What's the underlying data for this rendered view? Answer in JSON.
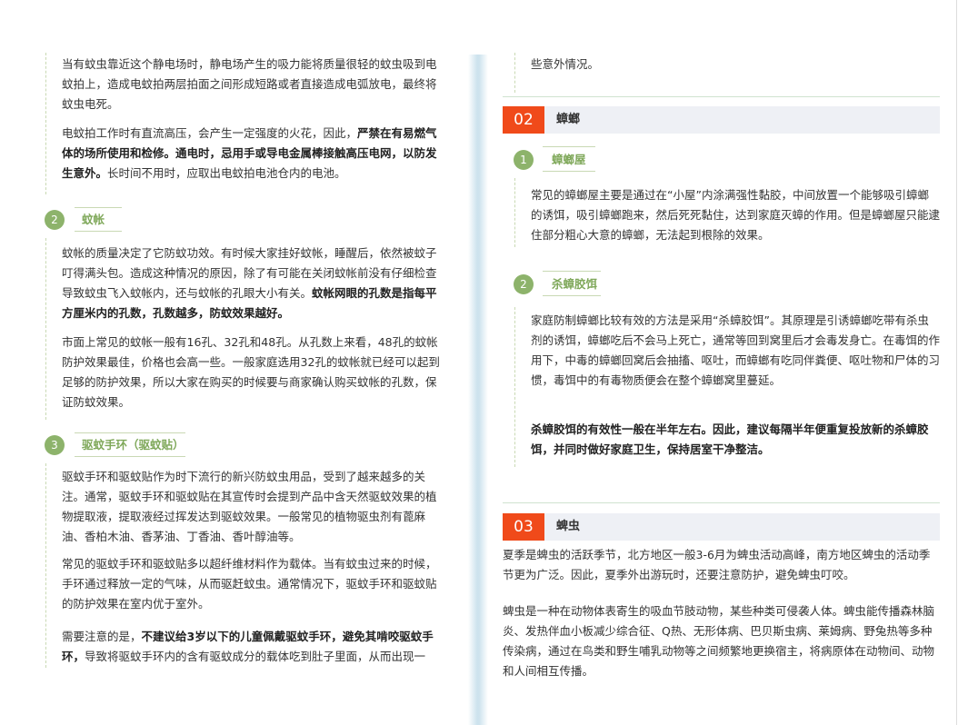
{
  "left": {
    "p1": "当有蚊虫靠近这个静电场时，静电场产生的吸力能将质量很轻的蚊虫吸到电蚊拍上，造成电蚊拍两层拍面之间形成短路或者直接造成电弧放电，最终将蚊虫电死。",
    "p2_a": "电蚊拍工作时有直流高压，会产生一定强度的火花，因此，",
    "p2_b": "严禁在有易燃气体的场所使用和检修。通电时，忌用手或导电金属棒接触高压电网，以防发生意外。",
    "p2_c": "长时间不用时，应取出电蚊拍电池仓内的电池。",
    "sub2_num": "2",
    "sub2_title": "蚊帐",
    "p3_a": "蚊帐的质量决定了它防蚊功效。有时候大家挂好蚊帐，睡醒后，依然被蚊子叮得满头包。造成这种情况的原因，除了有可能在关闭蚊帐前没有仔细检查导致蚊虫飞入蚊帐内，还与蚊帐的孔眼大小有关。",
    "p3_b": "蚊帐网眼的孔数是指每平方厘米内的孔数，孔数越多，防蚊效果越好。",
    "p4": "市面上常见的蚊帐一般有16孔、32孔和48孔。从孔数上来看，48孔的蚊帐防护效果最佳，价格也会高一些。一般家庭选用32孔的蚊帐就已经可以起到足够的防护效果，所以大家在购买的时候要与商家确认购买蚊帐的孔数，保证防蚊效果。",
    "sub3_num": "3",
    "sub3_title": "驱蚊手环（驱蚊贴）",
    "p5": "驱蚊手环和驱蚊贴作为时下流行的新兴防蚊虫用品，受到了越来越多的关注。通常，驱蚊手环和驱蚊贴在其宣传时会提到产品中含天然驱蚊效果的植物提取液，提取液经过挥发达到驱蚊效果。一般常见的植物驱虫剂有蓖麻油、香柏木油、香茅油、丁香油、香叶醇油等。",
    "p6": "常见的驱蚊手环和驱蚊贴多以超纤维材料作为载体。当有蚊虫过来的时候，手环通过释放一定的气味，从而驱赶蚊虫。通常情况下，驱蚊手环和驱蚊贴的防护效果在室内优于室外。",
    "p7_a": "需要注意的是，",
    "p7_b": "不建议给3岁以下的儿童佩戴驱蚊手环，避免其啃咬驱蚊手环，",
    "p7_c": "导致将驱蚊手环内的含有驱蚊成分的载体吃到肚子里面，从而出现一"
  },
  "right": {
    "p0": "些意外情况。",
    "sec2_num": "02",
    "sec2_title": "蟑螂",
    "s1_num": "1",
    "s1_title": "蟑螂屋",
    "p1": "常见的蟑螂屋主要是通过在“小屋”内涂满强性黏胶，中间放置一个能够吸引蟑螂的诱饵，吸引蟑螂跑来，然后死死黏住，达到家庭灭蟑的作用。但是蟑螂屋只能逮住部分粗心大意的蟑螂，无法起到根除的效果。",
    "s2_num": "2",
    "s2_title": "杀蟑胶饵",
    "p2": "家庭防制蟑螂比较有效的方法是采用“杀蟑胶饵”。其原理是引诱蟑螂吃带有杀虫剂的诱饵，蟑螂吃后不会马上死亡，通常等回到窝里后才会毒发身亡。在毒饵的作用下，中毒的蟑螂回窝后会抽搐、呕吐，而蟑螂有吃同伴粪便、呕吐物和尸体的习惯，毒饵中的有毒物质便会在整个蟑螂窝里蔓延。",
    "p3": "杀蟑胶饵的有效性一般在半年左右。因此，建议每隔半年便重复投放新的杀蟑胶饵，并同时做好家庭卫生，保持居室干净整洁。",
    "sec3_num": "03",
    "sec3_title": "蜱虫",
    "p4": "夏季是蜱虫的活跃季节，北方地区一般3-6月为蜱虫活动高峰，南方地区蜱虫的活动季节更为广泛。因此，夏季外出游玩时，还要注意防护，避免蜱虫叮咬。",
    "p5": "蜱虫是一种在动物体表寄生的吸血节肢动物，某些种类可侵袭人体。蜱虫能传播森林脑炎、发热伴血小板减少综合征、Q热、无形体病、巴贝斯虫病、莱姆病、野兔热等多种传染病，通过在鸟类和野生哺乳动物等之间频繁地更换宿主，将病原体在动物间、动物和人间相互传播。"
  }
}
